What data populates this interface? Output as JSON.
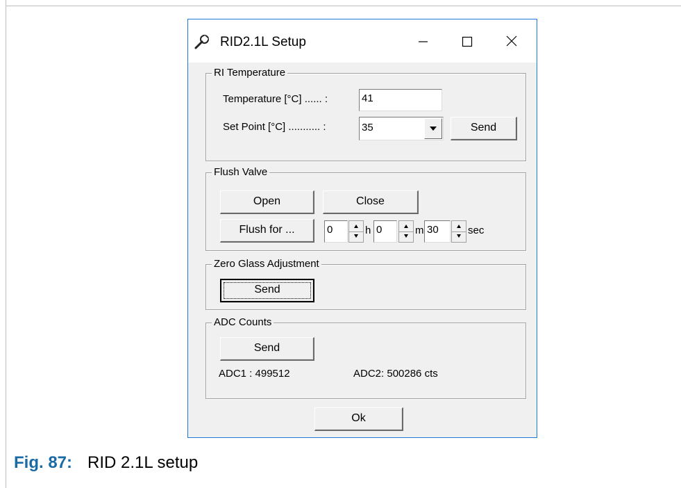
{
  "window": {
    "title": "RID2.1L Setup",
    "icon": "wrench-icon",
    "controls": {
      "minimize": "minimize-icon",
      "maximize": "maximize-icon",
      "close": "close-icon"
    }
  },
  "ri_temperature": {
    "legend": "RI Temperature",
    "temperature_label": "Temperature [°C] ...... :",
    "temperature_value": "41",
    "setpoint_label": "Set Point [°C]  ........... :",
    "setpoint_value": "35",
    "send_label": "Send"
  },
  "flush_valve": {
    "legend": "Flush Valve",
    "open_label": "Open",
    "close_label": "Close",
    "flush_for_label": "Flush for ...",
    "hours_value": "0",
    "hours_unit": "h",
    "minutes_value": "0",
    "minutes_unit": "m",
    "seconds_value": "30",
    "seconds_unit": "sec"
  },
  "zero_glass": {
    "legend": "Zero Glass Adjustment",
    "send_label": "Send"
  },
  "adc_counts": {
    "legend": "ADC Counts",
    "send_label": "Send",
    "adc1_text": "ADC1 : 499512",
    "adc2_text": "ADC2: 500286 cts"
  },
  "ok_label": "Ok",
  "caption": {
    "fig_label": "Fig. 87:",
    "text": "RID 2.1L setup"
  },
  "colors": {
    "accent_border": "#1c79d6",
    "caption_fig": "#1a6aa6",
    "dialog_bg": "#f0f0f0"
  }
}
